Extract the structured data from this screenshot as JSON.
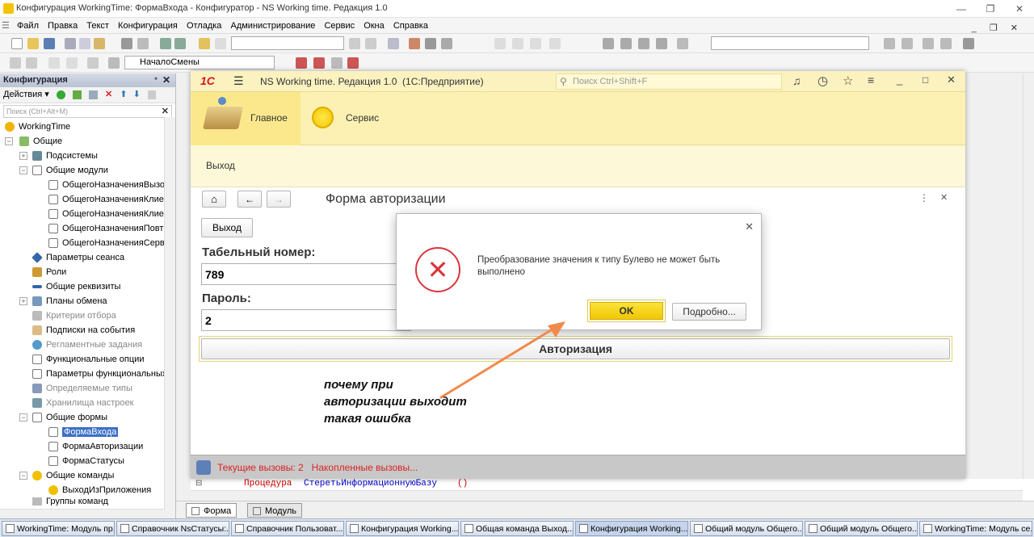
{
  "window": {
    "title": "Конфигурация WorkingTime: ФормаВхода - Конфигуратор - NS Working time. Редакция 1.0",
    "controls": [
      "—",
      "❐",
      "✕"
    ],
    "inner_controls": [
      "_",
      "❐",
      "✕"
    ]
  },
  "menu": [
    "Файл",
    "Правка",
    "Текст",
    "Конфигурация",
    "Отладка",
    "Администрирование",
    "Сервис",
    "Окна",
    "Справка"
  ],
  "toolbar2": {
    "procedure_combo": "НачалоСмены"
  },
  "config_panel": {
    "title": "Конфигурация",
    "actions_label": "Действия ▾",
    "search_placeholder": "Поиск (Ctrl+Alt+M)",
    "tree": [
      {
        "label": "WorkingTime"
      },
      {
        "label": "Общие"
      },
      {
        "label": "Подсистемы"
      },
      {
        "label": "Общие модули"
      },
      {
        "label": "ОбщегоНазначенияВызов"
      },
      {
        "label": "ОбщегоНазначенияКлиен"
      },
      {
        "label": "ОбщегоНазначенияКлиен"
      },
      {
        "label": "ОбщегоНазначенияПовтИ"
      },
      {
        "label": "ОбщегоНазначенияСерве"
      },
      {
        "label": "Параметры сеанса"
      },
      {
        "label": "Роли"
      },
      {
        "label": "Общие реквизиты"
      },
      {
        "label": "Планы обмена"
      },
      {
        "label": "Критерии отбора"
      },
      {
        "label": "Подписки на события"
      },
      {
        "label": "Регламентные задания"
      },
      {
        "label": "Функциональные опции"
      },
      {
        "label": "Параметры функциональных"
      },
      {
        "label": "Определяемые типы"
      },
      {
        "label": "Хранилища настроек"
      },
      {
        "label": "Общие формы"
      },
      {
        "label": "ФормаВхода"
      },
      {
        "label": "ФормаАвторизации"
      },
      {
        "label": "ФормаСтатусы"
      },
      {
        "label": "Общие команды"
      },
      {
        "label": "ВыходИзПриложения"
      },
      {
        "label": "Группы команд"
      }
    ]
  },
  "app": {
    "logo": "1С",
    "title": "NS Working time. Редакция 1.0  (1С:Предприятие)",
    "search_placeholder": "Поиск Ctrl+Shift+F",
    "sections": [
      {
        "label": "Главное"
      },
      {
        "label": "Сервис"
      }
    ],
    "exit_command": "Выход",
    "form_title": "Форма авторизации",
    "form_exit_button": "Выход",
    "tab_label": "Табельный номер:",
    "tab_value": "789",
    "password_label": "Пароль:",
    "password_value": "2",
    "auth_button": "Авторизация",
    "status_text": "Текущие вызовы: 2   Накопленные вызовы..."
  },
  "dialog": {
    "message": "Преобразование значения к типу Булево не может быть выполнено",
    "ok": "OK",
    "details": "Подробно..."
  },
  "annotation": {
    "lines": [
      "почему при",
      "авторизации выходит",
      "такая ошибка"
    ]
  },
  "code": {
    "keyword": "Процедура",
    "name": "СтеретьИнформационнуюБазу",
    "parens": "()"
  },
  "bottom_tabs": [
    "Форма",
    "Модуль"
  ],
  "taskbar": [
    "WorkingTime: Модуль пр...",
    "Справочник NsСтатусы:...",
    "Справочник Пользоват...",
    "Конфигурация Working...",
    "Общая команда Выход...",
    "Конфигурация Working...",
    "Общий модуль Общего...",
    "Общий модуль Общего...",
    "WorkingTime: Модуль се..."
  ],
  "colors": {
    "accent_yellow": "#f5d400",
    "error_red": "#d9363e",
    "selection": "#3c6fc6",
    "arrow": "#f08a4b"
  }
}
